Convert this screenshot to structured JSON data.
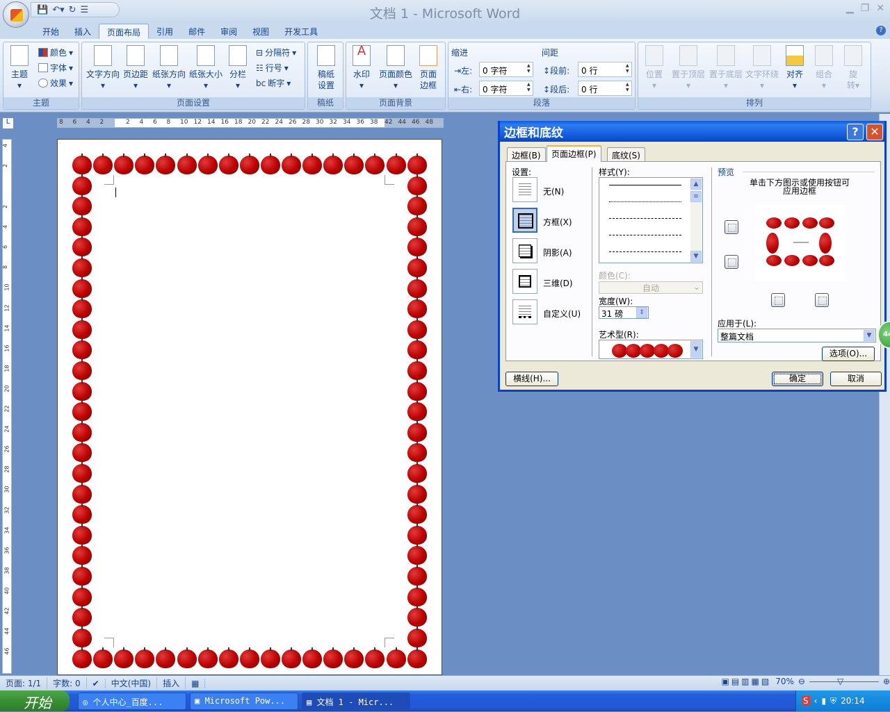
{
  "window": {
    "title": "文档 1 - Microsoft Word"
  },
  "ribbon": {
    "tabs": [
      "开始",
      "插入",
      "页面布局",
      "引用",
      "邮件",
      "审阅",
      "视图",
      "开发工具"
    ],
    "active_tab": "页面布局",
    "theme": {
      "label": "主题",
      "theme_btn": "主题",
      "colors": "颜色",
      "fonts": "字体",
      "effects": "效果"
    },
    "page_setup": {
      "label": "页面设置",
      "text_direction": "文字方向",
      "margins": "页边距",
      "orientation": "纸张方向",
      "size": "纸张大小",
      "columns": "分栏",
      "breaks": "分隔符",
      "line_numbers": "行号",
      "hyphenation": "断字"
    },
    "manuscript": {
      "label": "稿纸",
      "btn_line1": "稿纸",
      "btn_line2": "设置"
    },
    "page_background": {
      "label": "页面背景",
      "watermark": "水印",
      "page_color": "页面颜色",
      "borders_line1": "页面",
      "borders_line2": "边框"
    },
    "paragraph": {
      "label": "段落",
      "indent": "缩进",
      "spacing": "间距",
      "left": "左:",
      "right": "右:",
      "left_value": "0 字符",
      "right_value": "0 字符",
      "before": "段前:",
      "after": "段后:",
      "before_value": "0 行",
      "after_value": "0 行"
    },
    "arrange": {
      "label": "排列",
      "position": "位置",
      "bring_front": "置于顶层",
      "send_back": "置于底层",
      "text_wrap": "文字环绕",
      "align": "对齐",
      "group": "组合",
      "rotate_line1": "旋",
      "rotate_line2": "转"
    }
  },
  "ruler": {
    "horizontal": [
      "8",
      "6",
      "4",
      "2",
      "2",
      "4",
      "6",
      "8",
      "10",
      "12",
      "14",
      "16",
      "18",
      "20",
      "22",
      "24",
      "26",
      "28",
      "30",
      "32",
      "34",
      "36",
      "38",
      "42",
      "44",
      "46",
      "48"
    ],
    "vertical": [
      "4",
      "2",
      "2",
      "4",
      "6",
      "8",
      "10",
      "12",
      "14",
      "16",
      "18",
      "20",
      "22",
      "24",
      "26",
      "28",
      "30",
      "32",
      "34",
      "36",
      "38",
      "40",
      "42",
      "44",
      "46"
    ]
  },
  "document": {
    "art_border": "apples",
    "border_color": "#c00000"
  },
  "dialog": {
    "title": "边框和底纹",
    "help": "?",
    "tabs": [
      "边框(B)",
      "页面边框(P)",
      "底纹(S)"
    ],
    "active_tab": "页面边框(P)",
    "setting_label": "设置:",
    "settings": [
      "无(N)",
      "方框(X)",
      "阴影(A)",
      "三维(D)",
      "自定义(U)"
    ],
    "selected_setting": "方框(X)",
    "style_label": "样式(Y):",
    "color_label": "颜色(C):",
    "color_value": "自动",
    "width_label": "宽度(W):",
    "width_value": "31 磅",
    "art_label": "艺术型(R):",
    "preview_label": "预览",
    "preview_hint_line1": "单击下方图示或使用按钮可",
    "preview_hint_line2": "应用边框",
    "apply_to_label": "应用于(L):",
    "apply_to_value": "整篇文档",
    "options_btn": "选项(O)...",
    "horizontal_line_btn": "横线(H)...",
    "ok_btn": "确定",
    "cancel_btn": "取消"
  },
  "floating_badge": "44",
  "statusbar": {
    "page": "页面: 1/1",
    "words": "字数: 0",
    "language": "中文(中国)",
    "mode": "插入",
    "zoom": "70%"
  },
  "taskbar": {
    "start": "开始",
    "tasks": [
      "个人中心_百度...",
      "Microsoft Pow...",
      "文档 1 - Micr..."
    ],
    "active_task": "文档 1 - Micr...",
    "clock": "20:14"
  }
}
